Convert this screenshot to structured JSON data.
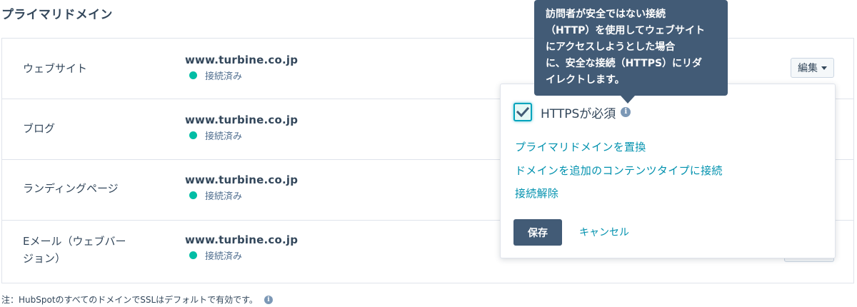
{
  "section_title": "プライマリドメイン",
  "rows": [
    {
      "label": "ウェブサイト",
      "domain": "www.turbine.co.jp",
      "status": "接続済み"
    },
    {
      "label": "ブログ",
      "domain": "www.turbine.co.jp",
      "status": "接続済み"
    },
    {
      "label": "ランディングページ",
      "domain": "www.turbine.co.jp",
      "status": "接続済み"
    },
    {
      "label_line1": "Eメール（ウェブバー",
      "label_line2": "ジョン）",
      "domain": "www.turbine.co.jp",
      "status": "接続済み"
    }
  ],
  "edit_button_label": "編集",
  "dropdown": {
    "https_label": "HTTPSが必須",
    "https_checked": true,
    "links": [
      "プライマリドメインを置換",
      "ドメインを追加のコンテンツタイプに接続",
      "接続解除"
    ],
    "save_label": "保存",
    "cancel_label": "キャンセル"
  },
  "tooltip": {
    "lines": [
      "訪問者が安全ではない接続",
      "（HTTP）を使用してウェブサイト",
      "にアクセスしようとした場合",
      "に、安全な接続（HTTPS）にリダ",
      "イレクトします。"
    ]
  },
  "footnote": "注：HubSpotのすべてのドメインでSSLはデフォルトで有効です。",
  "icons": {
    "info": "info-icon",
    "check": "check-icon",
    "caret": "chevron-down-icon"
  },
  "colors": {
    "text": "#33475b",
    "link": "#0091ae",
    "status_dot": "#00bda5",
    "tooltip_bg": "#425b76",
    "save_bg": "#425b76",
    "checkbox_border": "#00a4bd"
  }
}
